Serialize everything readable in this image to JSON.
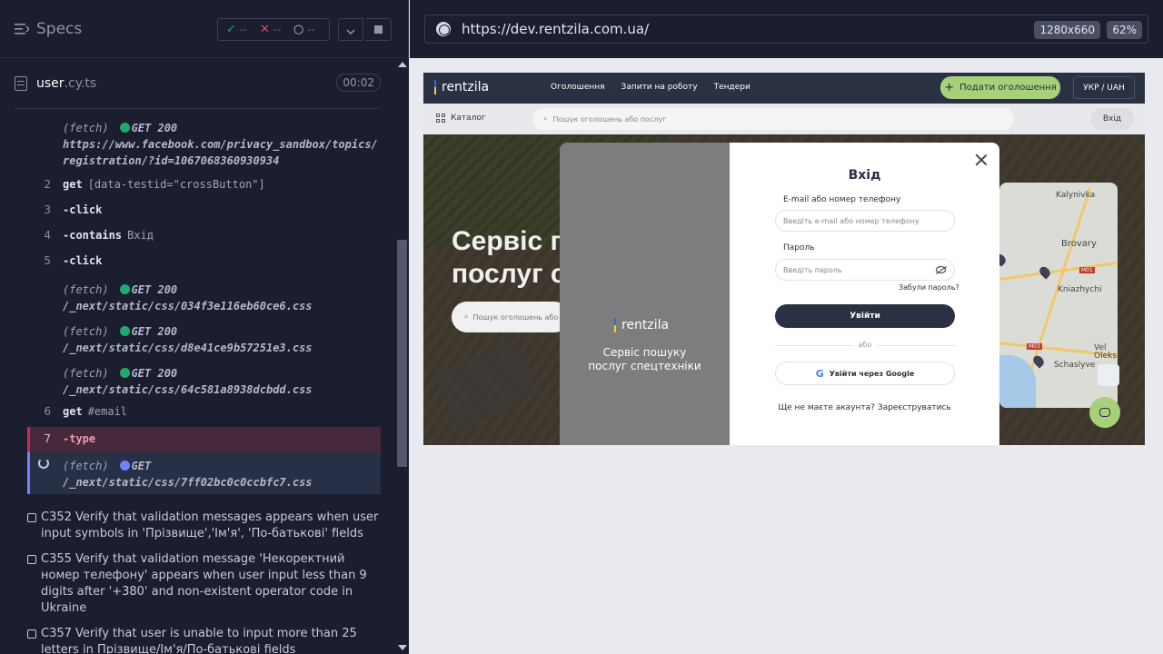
{
  "runner": {
    "specs_label": "Specs",
    "stats": {
      "passed": "--",
      "failed": "--",
      "pending": "--"
    },
    "spec_file": {
      "name": "user",
      "ext": ".cy.ts",
      "timer": "00:02"
    },
    "log": {
      "fetch1": {
        "prefix": "(fetch)",
        "status": "GET 200",
        "url_line1": "https://www.facebook.com/privacy_sandbox/topics/",
        "url_line2": "registration/?id=1067068360930934"
      },
      "cmd2": {
        "num": "2",
        "name": "get",
        "arg": "[data-testid=\"crossButton\"]"
      },
      "cmd3": {
        "num": "3",
        "name": "-click"
      },
      "cmd4": {
        "num": "4",
        "name": "-contains",
        "arg": "Вхід"
      },
      "cmd5": {
        "num": "5",
        "name": "-click"
      },
      "fetch2": {
        "prefix": "(fetch)",
        "status": "GET 200",
        "url": "/_next/static/css/034f3e116eb60ce6.css"
      },
      "fetch3": {
        "prefix": "(fetch)",
        "status": "GET 200",
        "url": "/_next/static/css/d8e41ce9b57251e3.css"
      },
      "fetch4": {
        "prefix": "(fetch)",
        "status": "GET 200",
        "url": "/_next/static/css/64c581a8938dcbdd.css"
      },
      "cmd6": {
        "num": "6",
        "name": "get",
        "arg": "#email"
      },
      "cmd7": {
        "num": "7",
        "name": "-type"
      },
      "fetch5": {
        "prefix": "(fetch)",
        "status": "GET",
        "url": "/_next/static/css/7ff02bc0c0ccbfc7.css"
      }
    },
    "tests": [
      "C352 Verify that validation messages appears when user input symbols in 'Прізвище','Ім'я', 'По-батькові' fields",
      "C355 Verify that validation message 'Некоректний номер телефону' appears when user input less than 9 digits after '+380' and non-existent operator code in Ukraine",
      "C357 Verify that user is unable to input more than 25 letters in Прізвище/Ім'я/По-батькові fields"
    ]
  },
  "preview": {
    "url": "https://dev.rentzila.com.ua/",
    "viewport_size": "1280x660",
    "zoom": "62%",
    "site": {
      "logo": "rentzila",
      "nav": [
        "Оголошення",
        "Запити на роботу",
        "Тендери"
      ],
      "submit_ad": "Подати оголошення",
      "lang": "УКР / UAH",
      "catalog": "Каталог",
      "search_placeholder": "Пошук оголошень або послуг",
      "login": "Вхід",
      "hero_title_line1": "Сервіс п",
      "hero_title_line2": "послуг с",
      "hero_search": "Пошук оголошень або",
      "map_labels": [
        "Kalynivka",
        "Brovary",
        "M01",
        "Kniazhychi",
        "M03",
        "Vel",
        "Oleks",
        "Schaslyve"
      ]
    },
    "modal": {
      "logo": "rentzila",
      "tagline_line1": "Сервіс пошуку",
      "tagline_line2": "послуг спецтехніки",
      "title": "Вхід",
      "email_label": "E-mail або номер телефону",
      "email_placeholder": "Введіть e-mail або номер телефону",
      "password_label": "Пароль",
      "password_placeholder": "Введіть пароль",
      "forgot": "Забули пароль?",
      "login_button": "Увійти",
      "or": "або",
      "google_button": "Увійти через Google",
      "no_account": "Ще не маєте акаунта?",
      "register": "Зареєструватись"
    }
  },
  "colors": {
    "pass": "#1fa971",
    "fail": "#c62b5c",
    "running": "#6f82ff",
    "brand_green": "#a6d17a"
  }
}
